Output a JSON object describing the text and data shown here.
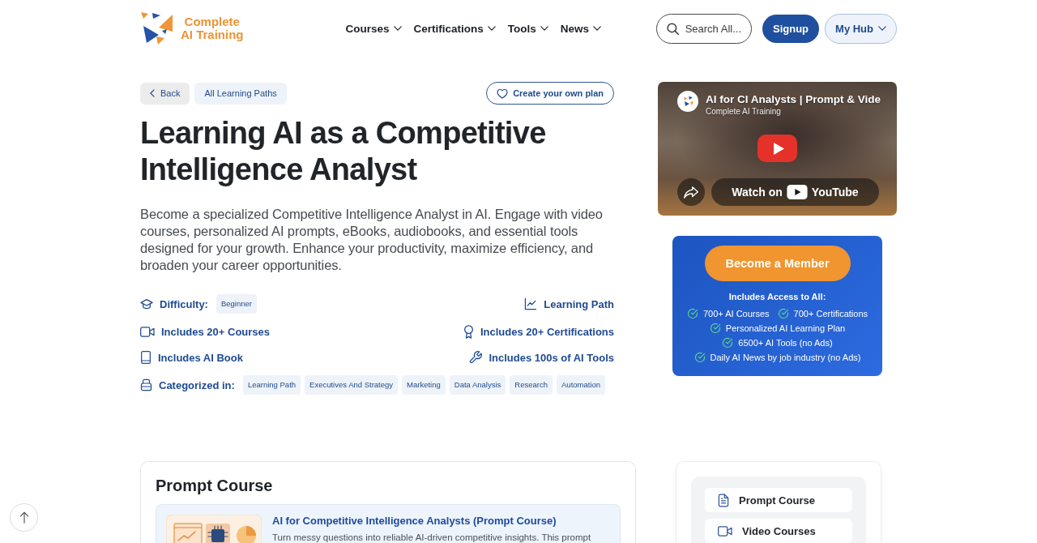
{
  "header": {
    "logo": {
      "lines": [
        "Complete",
        "AI Training"
      ]
    },
    "nav": [
      {
        "label": "Courses"
      },
      {
        "label": "Certifications"
      },
      {
        "label": "Tools"
      },
      {
        "label": "News"
      }
    ],
    "search": {
      "label": "Search All..."
    },
    "signup": {
      "label": "Signup"
    },
    "hub": {
      "label": "My Hub"
    }
  },
  "toolbar": {
    "back": "Back",
    "all_paths": "All Learning Paths",
    "create_plan": "Create your own plan"
  },
  "hero": {
    "title": "Learning AI as a Competitive Intelligence Analyst",
    "description": "Become a specialized Competitive Intelligence Analyst in AI. Engage with video courses, personalized AI prompts, eBooks, audiobooks, and essential tools designed for your growth. Enhance your productivity, maximize efficiency, and broaden your career opportunities."
  },
  "details": {
    "rows": [
      {
        "left": {
          "kind": "difficulty",
          "label": "Difficulty:",
          "badge": "Beginner"
        },
        "right": {
          "kind": "path",
          "label": "Learning Path"
        }
      },
      {
        "left": {
          "kind": "courses",
          "label": "Includes 20+ Courses"
        },
        "right": {
          "kind": "certifications",
          "label": "Includes 20+ Certifications"
        }
      },
      {
        "left": {
          "kind": "book",
          "label": "Includes AI Book"
        },
        "right": {
          "kind": "tools",
          "label": "Includes 100s of AI Tools"
        }
      }
    ],
    "categories": {
      "label": "Categorized in:",
      "tags": [
        "Learning Path",
        "Executives And Strategy",
        "Marketing",
        "Data Analysis",
        "Research",
        "Automation"
      ]
    }
  },
  "video": {
    "title": "AI for CI Analysts | Prompt & Vide",
    "channel": "Complete AI Training",
    "watch_label": "Watch on",
    "platform": "YouTube"
  },
  "membership": {
    "button": "Become a Member",
    "heading": "Includes Access to All:",
    "features": [
      "700+ AI Courses",
      "700+ Certifications",
      "Personalized AI Learning Plan",
      "6500+ AI Tools (no Ads)",
      "Daily AI News by job industry (no Ads)"
    ]
  },
  "course_section": {
    "title": "Prompt Course",
    "items": [
      {
        "title": "AI for Competitive Intelligence Analysts (Prompt Course)",
        "description": "Turn messy questions into reliable AI-driven competitive insights. This prompt"
      }
    ]
  },
  "course_nav": {
    "items": [
      {
        "kind": "prompt",
        "label": "Prompt Course"
      },
      {
        "kind": "video",
        "label": "Video Courses"
      }
    ]
  }
}
